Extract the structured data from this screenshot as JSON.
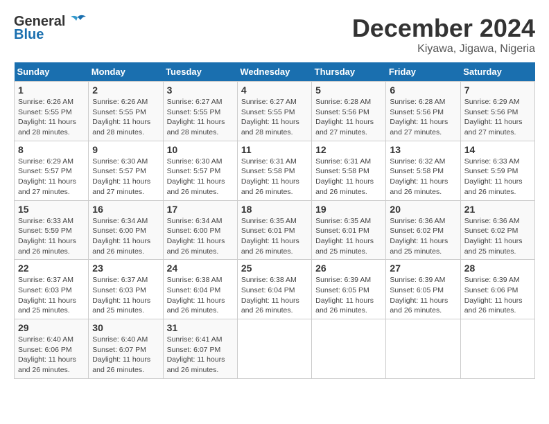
{
  "logo": {
    "text_general": "General",
    "text_blue": "Blue"
  },
  "title": "December 2024",
  "subtitle": "Kiyawa, Jigawa, Nigeria",
  "days_header": [
    "Sunday",
    "Monday",
    "Tuesday",
    "Wednesday",
    "Thursday",
    "Friday",
    "Saturday"
  ],
  "weeks": [
    [
      {
        "day": "1",
        "info": "Sunrise: 6:26 AM\nSunset: 5:55 PM\nDaylight: 11 hours\nand 28 minutes."
      },
      {
        "day": "2",
        "info": "Sunrise: 6:26 AM\nSunset: 5:55 PM\nDaylight: 11 hours\nand 28 minutes."
      },
      {
        "day": "3",
        "info": "Sunrise: 6:27 AM\nSunset: 5:55 PM\nDaylight: 11 hours\nand 28 minutes."
      },
      {
        "day": "4",
        "info": "Sunrise: 6:27 AM\nSunset: 5:55 PM\nDaylight: 11 hours\nand 28 minutes."
      },
      {
        "day": "5",
        "info": "Sunrise: 6:28 AM\nSunset: 5:56 PM\nDaylight: 11 hours\nand 27 minutes."
      },
      {
        "day": "6",
        "info": "Sunrise: 6:28 AM\nSunset: 5:56 PM\nDaylight: 11 hours\nand 27 minutes."
      },
      {
        "day": "7",
        "info": "Sunrise: 6:29 AM\nSunset: 5:56 PM\nDaylight: 11 hours\nand 27 minutes."
      }
    ],
    [
      {
        "day": "8",
        "info": "Sunrise: 6:29 AM\nSunset: 5:57 PM\nDaylight: 11 hours\nand 27 minutes."
      },
      {
        "day": "9",
        "info": "Sunrise: 6:30 AM\nSunset: 5:57 PM\nDaylight: 11 hours\nand 27 minutes."
      },
      {
        "day": "10",
        "info": "Sunrise: 6:30 AM\nSunset: 5:57 PM\nDaylight: 11 hours\nand 26 minutes."
      },
      {
        "day": "11",
        "info": "Sunrise: 6:31 AM\nSunset: 5:58 PM\nDaylight: 11 hours\nand 26 minutes."
      },
      {
        "day": "12",
        "info": "Sunrise: 6:31 AM\nSunset: 5:58 PM\nDaylight: 11 hours\nand 26 minutes."
      },
      {
        "day": "13",
        "info": "Sunrise: 6:32 AM\nSunset: 5:58 PM\nDaylight: 11 hours\nand 26 minutes."
      },
      {
        "day": "14",
        "info": "Sunrise: 6:33 AM\nSunset: 5:59 PM\nDaylight: 11 hours\nand 26 minutes."
      }
    ],
    [
      {
        "day": "15",
        "info": "Sunrise: 6:33 AM\nSunset: 5:59 PM\nDaylight: 11 hours\nand 26 minutes."
      },
      {
        "day": "16",
        "info": "Sunrise: 6:34 AM\nSunset: 6:00 PM\nDaylight: 11 hours\nand 26 minutes."
      },
      {
        "day": "17",
        "info": "Sunrise: 6:34 AM\nSunset: 6:00 PM\nDaylight: 11 hours\nand 26 minutes."
      },
      {
        "day": "18",
        "info": "Sunrise: 6:35 AM\nSunset: 6:01 PM\nDaylight: 11 hours\nand 26 minutes."
      },
      {
        "day": "19",
        "info": "Sunrise: 6:35 AM\nSunset: 6:01 PM\nDaylight: 11 hours\nand 25 minutes."
      },
      {
        "day": "20",
        "info": "Sunrise: 6:36 AM\nSunset: 6:02 PM\nDaylight: 11 hours\nand 25 minutes."
      },
      {
        "day": "21",
        "info": "Sunrise: 6:36 AM\nSunset: 6:02 PM\nDaylight: 11 hours\nand 25 minutes."
      }
    ],
    [
      {
        "day": "22",
        "info": "Sunrise: 6:37 AM\nSunset: 6:03 PM\nDaylight: 11 hours\nand 25 minutes."
      },
      {
        "day": "23",
        "info": "Sunrise: 6:37 AM\nSunset: 6:03 PM\nDaylight: 11 hours\nand 25 minutes."
      },
      {
        "day": "24",
        "info": "Sunrise: 6:38 AM\nSunset: 6:04 PM\nDaylight: 11 hours\nand 26 minutes."
      },
      {
        "day": "25",
        "info": "Sunrise: 6:38 AM\nSunset: 6:04 PM\nDaylight: 11 hours\nand 26 minutes."
      },
      {
        "day": "26",
        "info": "Sunrise: 6:39 AM\nSunset: 6:05 PM\nDaylight: 11 hours\nand 26 minutes."
      },
      {
        "day": "27",
        "info": "Sunrise: 6:39 AM\nSunset: 6:05 PM\nDaylight: 11 hours\nand 26 minutes."
      },
      {
        "day": "28",
        "info": "Sunrise: 6:39 AM\nSunset: 6:06 PM\nDaylight: 11 hours\nand 26 minutes."
      }
    ],
    [
      {
        "day": "29",
        "info": "Sunrise: 6:40 AM\nSunset: 6:06 PM\nDaylight: 11 hours\nand 26 minutes."
      },
      {
        "day": "30",
        "info": "Sunrise: 6:40 AM\nSunset: 6:07 PM\nDaylight: 11 hours\nand 26 minutes."
      },
      {
        "day": "31",
        "info": "Sunrise: 6:41 AM\nSunset: 6:07 PM\nDaylight: 11 hours\nand 26 minutes."
      },
      {
        "day": "",
        "info": ""
      },
      {
        "day": "",
        "info": ""
      },
      {
        "day": "",
        "info": ""
      },
      {
        "day": "",
        "info": ""
      }
    ]
  ]
}
